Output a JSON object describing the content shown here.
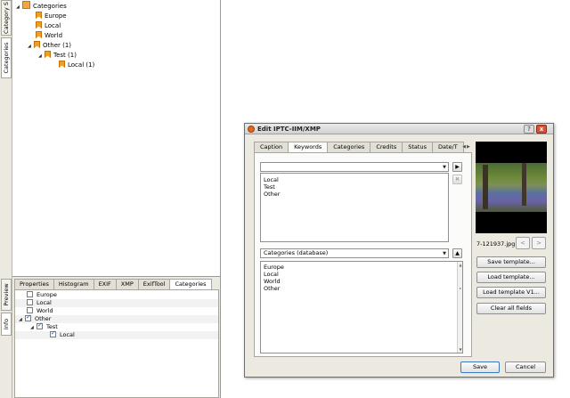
{
  "side_tabs": {
    "category": "Category S",
    "categories": "Categories",
    "preview": "Preview",
    "info": "Info"
  },
  "tree": {
    "root": "Categories",
    "items": [
      "Europe",
      "Local",
      "World",
      "Other (1)",
      "Test (1)",
      "Local (1)"
    ]
  },
  "bottom_panel": {
    "tabs": [
      "Properties",
      "Histogram",
      "EXIF",
      "XMP",
      "ExifTool",
      "Categories"
    ],
    "active_tab": "Categories",
    "items": [
      "Europe",
      "Local",
      "World",
      "Other",
      "Test",
      "Local"
    ],
    "checked": [
      false,
      false,
      false,
      true,
      true,
      true
    ]
  },
  "dialog": {
    "title": "Edit IPTC-IIM/XMP",
    "help": "?",
    "close": "x",
    "tabs": [
      "Caption",
      "Keywords",
      "Categories",
      "Credits",
      "Status",
      "Date/T"
    ],
    "active_tab": "Keywords",
    "keyword_combo_value": "",
    "keywords": [
      "Local",
      "Test",
      "Other"
    ],
    "categories_combo_value": "Categories (database)",
    "database_categories": [
      "Europe",
      "Local",
      "World",
      "Other"
    ],
    "filename": "7-121937.jpg",
    "prev": "<",
    "next": ">",
    "buttons": {
      "save_template": "Save template...",
      "load_template": "Load template...",
      "load_template_v1": "Load template V1...",
      "clear_all": "Clear all fields"
    },
    "save": "Save",
    "cancel": "Cancel"
  },
  "icons": [
    "category-icon",
    "root-category-icon",
    "checkbox",
    "add-icon",
    "remove-icon",
    "dropdown-icon",
    "up-icon"
  ]
}
